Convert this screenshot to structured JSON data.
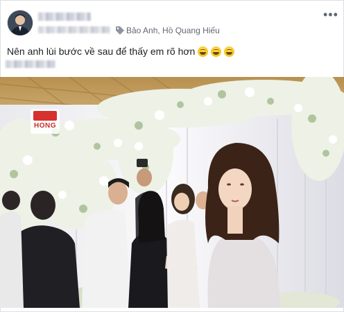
{
  "post": {
    "checkin": "Bảo Anh, Hồ Quang Hiếu",
    "caption": "Nên anh lùi bước về sau để thấy em rõ hơn",
    "emoji": [
      "grinning-face-emoji",
      "grinning-face-emoji",
      "grinning-face-emoji"
    ],
    "more_symbol": "•••"
  },
  "photo": {
    "watermark_text": "HONG",
    "colors": {
      "accent": "#d6312f",
      "backdrop": "#f2f2f4",
      "flowers": "#eef1e6"
    }
  }
}
